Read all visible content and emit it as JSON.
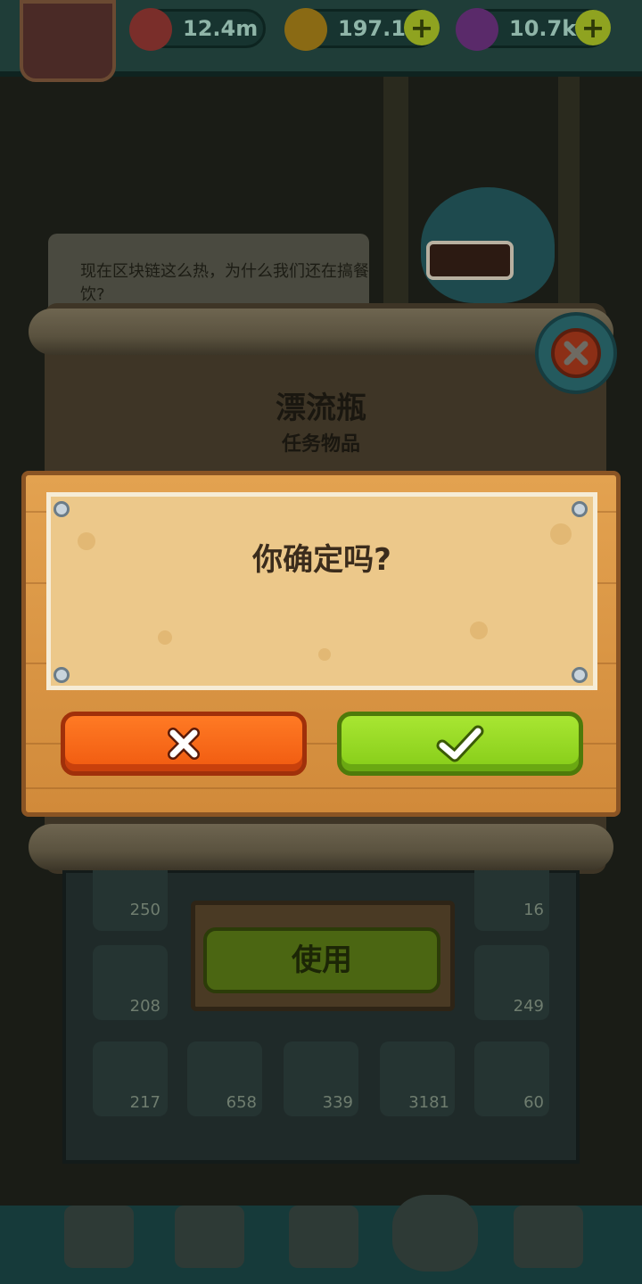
{
  "resources": [
    {
      "icon": "eyeball-icon",
      "value": "12.4m"
    },
    {
      "icon": "coin-icon",
      "value": "197.1m"
    },
    {
      "icon": "potion-icon",
      "value": "10.7k"
    }
  ],
  "npc_dialog": "现在区块链这么热，为什么我们还在搞餐饮?",
  "item": {
    "name": "漂流瓶",
    "type": "任务物品"
  },
  "inventory_counts": [
    "250",
    "16",
    "208",
    "249",
    "217",
    "658",
    "339",
    "3181",
    "60"
  ],
  "use_button_label": "使用",
  "confirm_dialog": {
    "question": "你确定吗?",
    "cancel_icon": "x-icon",
    "confirm_icon": "checkmark-icon"
  },
  "colors": {
    "cancel": "#f05a10",
    "confirm": "#86cc18",
    "wood": "#d18a3a",
    "parchment": "#ecc88a"
  }
}
